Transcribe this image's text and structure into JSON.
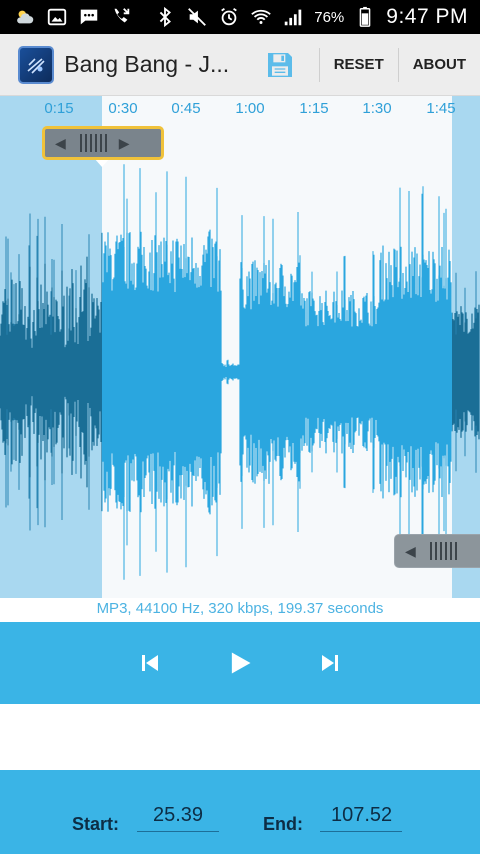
{
  "status_bar": {
    "icons": [
      "weather-icon",
      "image-icon",
      "message-icon",
      "missed-call-icon",
      "bluetooth-icon",
      "mute-icon",
      "alarm-icon",
      "wifi-icon",
      "signal-icon",
      "battery-icon"
    ],
    "battery": "76%",
    "time": "9:47 PM"
  },
  "app_bar": {
    "title": "Bang Bang - J...",
    "reset_label": "RESET",
    "about_label": "ABOUT"
  },
  "timeline": {
    "ticks": [
      "0:15",
      "0:30",
      "0:45",
      "1:00",
      "1:15",
      "1:30",
      "1:45"
    ]
  },
  "file_info": "MP3, 44100 Hz, 320 kbps, 199.37 seconds",
  "controls": {
    "buttons": [
      "skip-previous-icon",
      "play-icon",
      "skip-next-icon"
    ]
  },
  "trim": {
    "start_label": "Start:",
    "start_value": "25.39",
    "end_label": "End:",
    "end_value": "107.52"
  },
  "colors": {
    "accent": "#3ab4e6",
    "wave": "#2aa6df",
    "wave_dim": "#1a6e96",
    "selection_highlight": "#f0c23a"
  }
}
